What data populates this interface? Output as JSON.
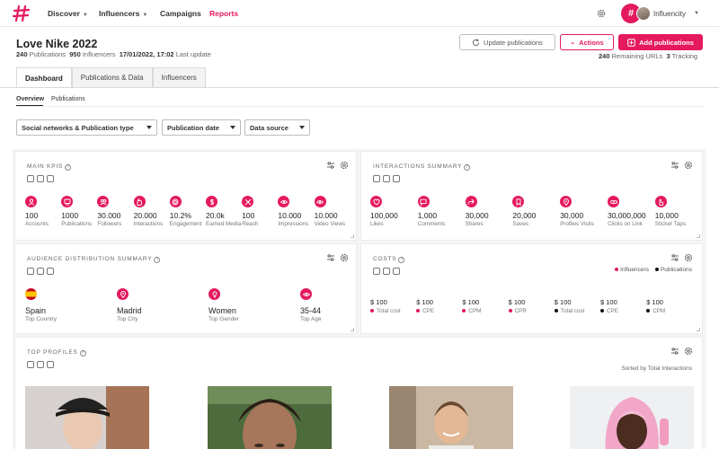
{
  "nav": {
    "logo_icon": "influencity-hash-logo",
    "items": [
      {
        "label": "Discover",
        "dropdown": true
      },
      {
        "label": "Influencers",
        "dropdown": true
      },
      {
        "label": "Campaigns",
        "dropdown": false
      },
      {
        "label": "Reports",
        "dropdown": false,
        "active": true
      }
    ],
    "user_name": "Influencity"
  },
  "header": {
    "title": "Love Nike 2022",
    "publications_count": "240",
    "publications_label": "Publications",
    "influencers_count": "950",
    "influencers_label": "Influencers",
    "last_update": "17/01/2022, 17:02",
    "last_update_label": "Last update",
    "update_button": "Update publications",
    "actions_button": "Actions",
    "add_button": "Add publications",
    "remaining_count": "240",
    "remaining_label": "Remaining URLs",
    "tracking_count": "3",
    "tracking_label": "Tracking"
  },
  "tabs": [
    "Dashboard",
    "Publications & Data",
    "Influencers"
  ],
  "subtabs": [
    "Overview",
    "Publications"
  ],
  "filters": [
    "Social networks & Publication type",
    "Publication date",
    "Data source"
  ],
  "main_kpis": {
    "title": "Main KPIs",
    "items": [
      {
        "value": "100",
        "label": "Accounts",
        "icon": "user-icon"
      },
      {
        "value": "1000",
        "label": "Publications",
        "icon": "publications-icon"
      },
      {
        "value": "30.000",
        "label": "Followers",
        "icon": "followers-icon"
      },
      {
        "value": "20.000",
        "label": "Interactions",
        "icon": "hand-icon"
      },
      {
        "value": "10.2%",
        "label": "Engagement",
        "icon": "target-icon"
      },
      {
        "value": "20.0k",
        "label": "Earned Media",
        "icon": "dollar-icon"
      },
      {
        "value": "100",
        "label": "Reach",
        "icon": "reach-icon"
      },
      {
        "value": "10.000",
        "label": "Impressions",
        "icon": "eye-icon"
      },
      {
        "value": "10.000",
        "label": "Video Views",
        "icon": "eye-icon"
      }
    ]
  },
  "interactions": {
    "title": "Interactions summary",
    "items": [
      {
        "value": "100,000",
        "label": "Likes",
        "icon": "heart-icon"
      },
      {
        "value": "1,000",
        "label": "Comments",
        "icon": "comment-icon"
      },
      {
        "value": "30,000",
        "label": "Shares",
        "icon": "share-icon"
      },
      {
        "value": "20,000",
        "label": "Saves",
        "icon": "bookmark-icon"
      },
      {
        "value": "30,000",
        "label": "Profiles Visits",
        "icon": "profile-visit-icon"
      },
      {
        "value": "30,000,000",
        "label": "Clicks on Link",
        "icon": "link-icon"
      },
      {
        "value": "10,000",
        "label": "Sticker Taps",
        "icon": "tap-icon"
      }
    ]
  },
  "audience": {
    "title": "Audience distribution summary",
    "items": [
      {
        "value": "Spain",
        "label": "Top Country",
        "icon": "spain-flag-icon"
      },
      {
        "value": "Madrid",
        "label": "Top City",
        "icon": "location-pin-icon"
      },
      {
        "value": "Women",
        "label": "Top Gender",
        "icon": "female-icon"
      },
      {
        "value": "35-44",
        "label": "Top Age",
        "icon": "eye-icon"
      }
    ]
  },
  "costs": {
    "title": "Costs",
    "legend": [
      {
        "label": "Influencers",
        "color": "#e5195e"
      },
      {
        "label": "Publications",
        "color": "#111111"
      }
    ],
    "items": [
      {
        "value": "$ 100",
        "label": "Total cost",
        "color": "#e5195e"
      },
      {
        "value": "$ 100",
        "label": "CPE",
        "color": "#e5195e"
      },
      {
        "value": "$ 100",
        "label": "CPM",
        "color": "#e5195e"
      },
      {
        "value": "$ 100",
        "label": "CPR",
        "color": "#e5195e"
      },
      {
        "value": "$ 100",
        "label": "Total cost",
        "color": "#111111"
      },
      {
        "value": "$ 100",
        "label": "CPE",
        "color": "#111111"
      },
      {
        "value": "$ 100",
        "label": "CPM",
        "color": "#111111"
      }
    ]
  },
  "top_profiles": {
    "title": "Top profiles",
    "sorted_label": "Sorted by Total Interactions"
  },
  "colors": {
    "accent": "#e5195e",
    "text": "#222222",
    "muted": "#777777"
  }
}
